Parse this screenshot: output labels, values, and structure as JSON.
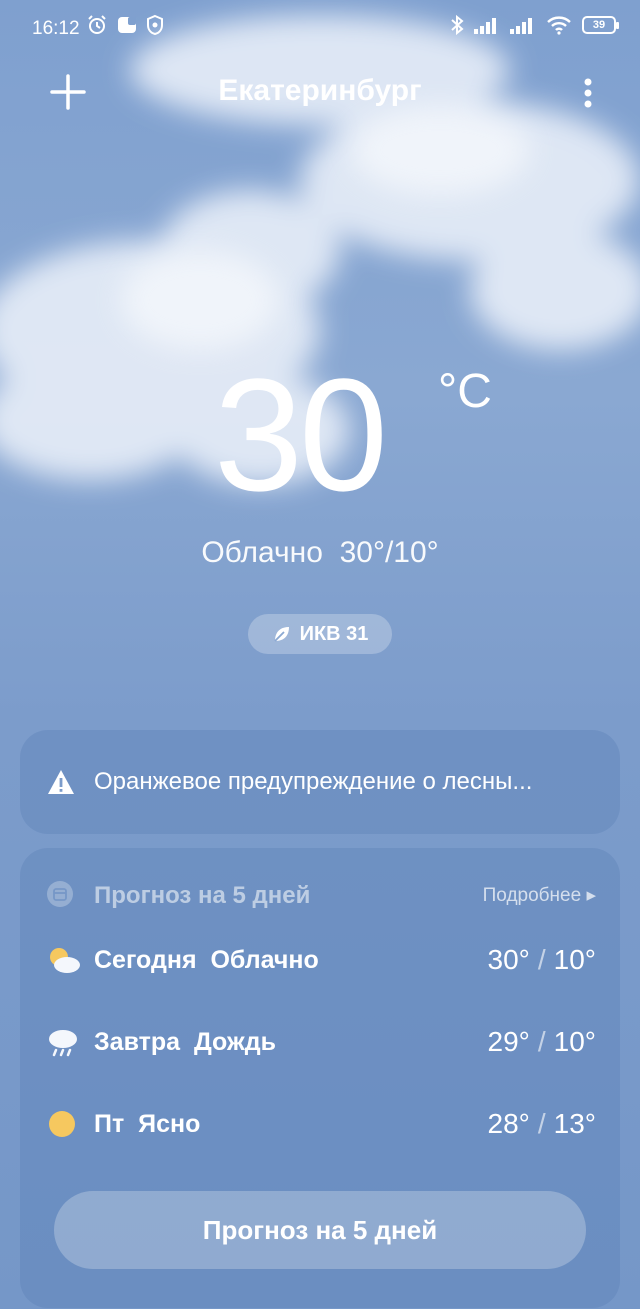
{
  "status_bar": {
    "time": "16:12",
    "battery": "39"
  },
  "header": {
    "city": "Екатеринбург"
  },
  "current": {
    "temperature": "30",
    "unit": "°C",
    "condition": "Облачно",
    "high_low": "30°/10°",
    "aqi": "ИКВ 31"
  },
  "alert": {
    "text": "Оранжевое предупреждение о лесны..."
  },
  "forecast": {
    "title": "Прогноз на 5 дней",
    "more_label": "Подробнее ▸",
    "days": [
      {
        "day": "Сегодня",
        "condition": "Облачно",
        "high": "30°",
        "low": "10°",
        "icon": "partly-cloudy-icon"
      },
      {
        "day": "Завтра",
        "condition": "Дождь",
        "high": "29°",
        "low": "10°",
        "icon": "rain-icon"
      },
      {
        "day": "Пт",
        "condition": "Ясно",
        "high": "28°",
        "low": "13°",
        "icon": "sun-icon"
      }
    ],
    "button_label": "Прогноз на 5 дней"
  }
}
